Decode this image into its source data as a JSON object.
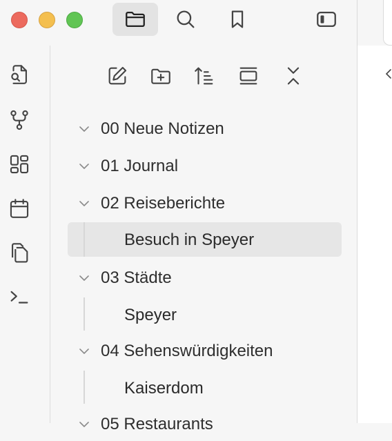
{
  "window": {
    "traffic_lights": {
      "close_color": "#ec6a5e",
      "minimize_color": "#f4bf4f",
      "zoom_color": "#61c554"
    }
  },
  "topbar": {
    "buttons": [
      {
        "icon": "folder-icon",
        "active": true
      },
      {
        "icon": "search-icon",
        "active": false
      },
      {
        "icon": "bookmark-icon",
        "active": false
      }
    ],
    "sidebar_toggle_icon": "sidebar-toggle-icon"
  },
  "ribbon": {
    "icons": [
      "quick-switcher-icon",
      "graph-view-icon",
      "canvas-icon",
      "daily-note-icon",
      "templates-icon",
      "command-palette-icon"
    ]
  },
  "explorer": {
    "toolbar": [
      "new-note-icon",
      "new-folder-icon",
      "sort-icon",
      "auto-reveal-icon",
      "collapse-all-icon"
    ],
    "tree": [
      {
        "type": "folder",
        "label": "00 Neue Notizen",
        "expanded": true
      },
      {
        "type": "folder",
        "label": "01 Journal",
        "expanded": true
      },
      {
        "type": "folder",
        "label": "02 Reiseberichte",
        "expanded": true
      },
      {
        "type": "file",
        "label": "Besuch in Speyer",
        "selected": true
      },
      {
        "type": "folder",
        "label": "03 Städte",
        "expanded": true
      },
      {
        "type": "file",
        "label": "Speyer",
        "selected": false
      },
      {
        "type": "folder",
        "label": "04 Sehenswürdigkeiten",
        "expanded": true
      },
      {
        "type": "file",
        "label": "Kaiserdom",
        "selected": false
      },
      {
        "type": "folder",
        "label": "05 Restaurants",
        "expanded": true
      }
    ]
  }
}
